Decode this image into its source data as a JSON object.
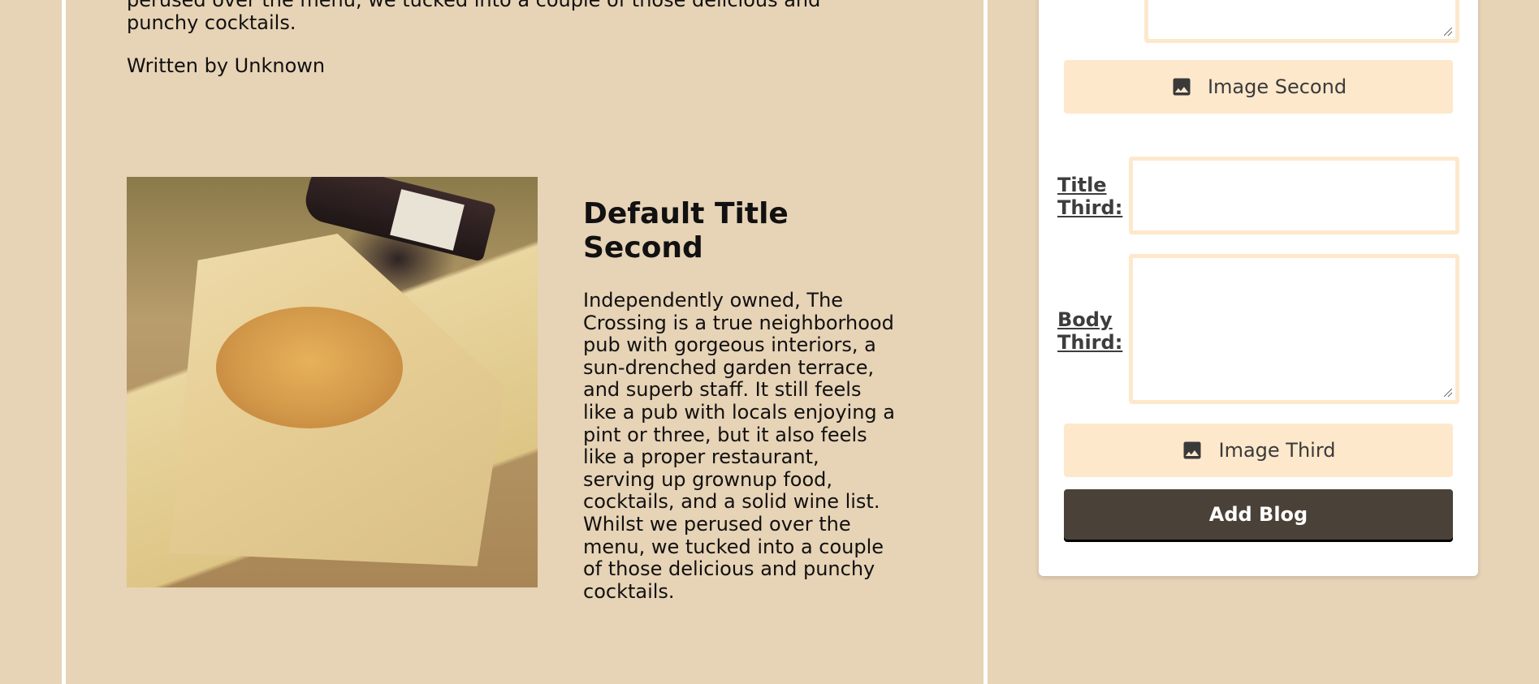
{
  "previous_post": {
    "text_tail": "perused over the menu, we tucked into a couple of those delicious and punchy cocktails.",
    "author": "Written by Unknown"
  },
  "post": {
    "title": "Default Title Second",
    "body": "Independently owned, The Crossing is a true neighborhood pub with gorgeous interiors, a sun-drenched garden terrace, and superb staff. It still feels like a pub with locals enjoying a pint or three, but it also feels like a proper restaurant, serving up grownup food, cocktails, and a solid wine list. Whilst we perused over the menu, we tucked into a couple of those delicious and punchy cocktails."
  },
  "form": {
    "image_second_label": "Image Second",
    "title_third_label": "Title Third:",
    "title_third_value": "",
    "body_third_label": "Body Third:",
    "body_third_value": "",
    "image_third_label": "Image Third",
    "submit_label": "Add Blog"
  },
  "icons": {
    "image_upload": "image-icon"
  },
  "colors": {
    "page_background": "#e7d3b6",
    "button_fill": "#fde8cc",
    "submit_fill": "#4a4238",
    "card_background": "#ffffff"
  }
}
